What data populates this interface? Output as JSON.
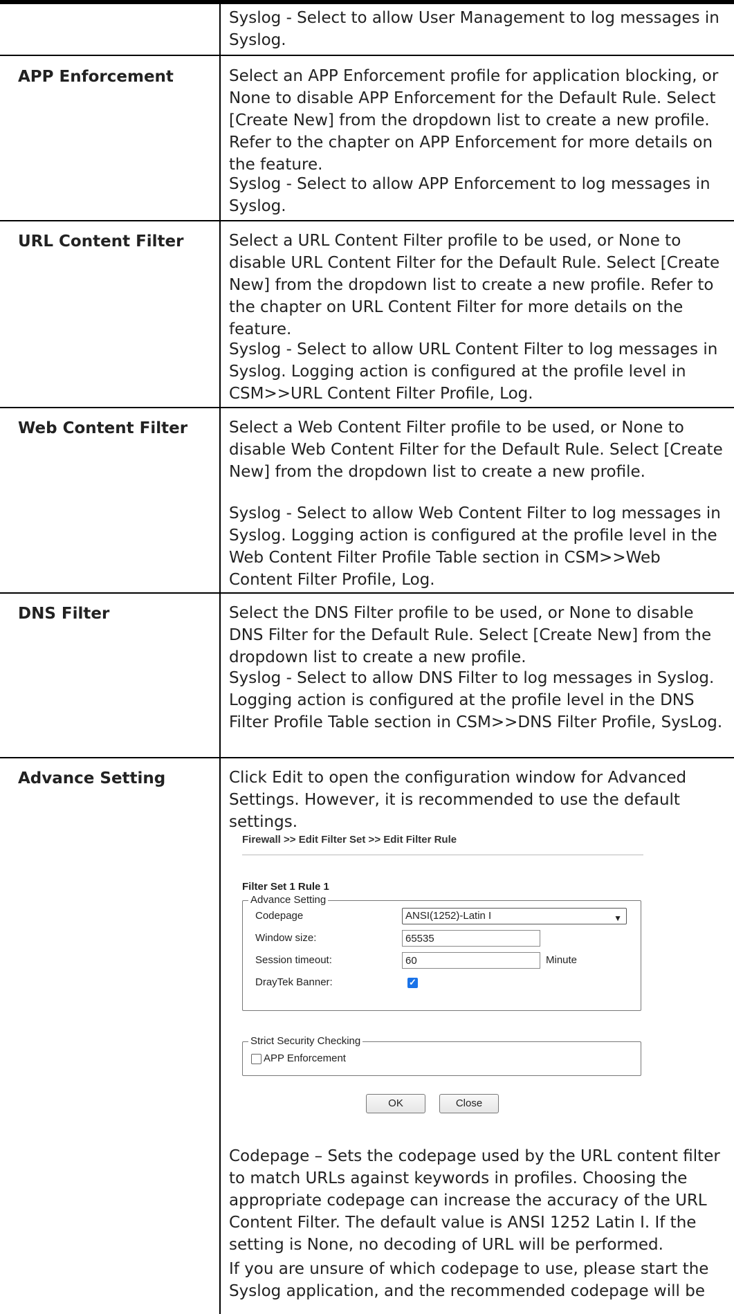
{
  "rows": {
    "user_management": {
      "syslog_keyword": "Syslog",
      "syslog_text": " - Select to allow User Management to log messages in Syslog."
    },
    "app_enforcement": {
      "label": "APP Enforcement",
      "desc": "Select an APP Enforcement profile for application blocking, or None to disable APP Enforcement for the Default Rule. Select [Create New] from the dropdown list to create a new profile. Refer to the chapter on APP Enforcement for more details on the feature.",
      "syslog_keyword": "Syslog",
      "syslog_text": " - Select to allow APP Enforcement to log messages in Syslog."
    },
    "url_content_filter": {
      "label": "URL Content Filter",
      "desc": "Select a URL Content Filter profile to be used, or None to disable URL Content Filter for the Default Rule. Select [Create New] from the dropdown list to create a new profile. Refer to the chapter on URL Content Filter for more details on the feature.",
      "syslog_keyword": "Syslog",
      "syslog_text": " - Select to allow URL Content Filter to log messages in Syslog. Logging action is configured at the profile level in CSM>>URL Content Filter Profile, Log."
    },
    "web_content_filter": {
      "label": "Web Content Filter",
      "desc": "Select a Web Content Filter profile to be used, or None to disable Web Content Filter for the Default Rule. Select [Create New] from the dropdown list to create a new profile.",
      "syslog_keyword": "Syslog",
      "syslog_text": " - Select to allow Web Content Filter to log messages in Syslog. Logging action is configured at the profile level in the Web Content Filter Profile Table section in CSM>>Web Content Filter Profile, Log."
    },
    "dns_filter": {
      "label": "DNS Filter",
      "desc": "Select the DNS Filter profile to be used, or None to disable DNS Filter for the Default Rule. Select [Create New] from the dropdown list to create a new profile.",
      "syslog_keyword": "Syslog",
      "syslog_text": " - Select to allow DNS Filter to log messages in Syslog. Logging action is configured at the profile level in the DNS Filter Profile Table section in CSM>>DNS Filter Profile, SysLog."
    },
    "advance_setting": {
      "label": "Advance Setting",
      "desc_pre": "Click ",
      "desc_keyword": "Edit",
      "desc_post": " to open the configuration window for Advanced Settings. However, it is recommended to use the default settings.",
      "codepage_keyword": "Codepage",
      "codepage_text": " – Sets the codepage used by the URL content filter to match URLs against keywords in profiles. Choosing the appropriate codepage can increase the accuracy of the URL Content Filter. The default value is ANSI 1252 Latin I. If the setting is None, no decoding of URL will be performed.",
      "unsure_text": "If you are unsure of which codepage to use, please start the Syslog application, and the recommended codepage will be"
    }
  },
  "screenshot": {
    "breadcrumb": "Firewall >> Edit Filter Set >> Edit Filter Rule",
    "set_title": "Filter Set 1 Rule 1",
    "advance_legend": "Advance Setting",
    "codepage_label": "Codepage",
    "codepage_value": "ANSI(1252)-Latin I",
    "window_size_label": "Window size:",
    "window_size_value": "65535",
    "session_timeout_label": "Session timeout:",
    "session_timeout_value": "60",
    "session_timeout_unit": "Minute",
    "banner_label": "DrayTek Banner:",
    "banner_checked": true,
    "strict_legend": "Strict Security Checking",
    "app_enforcement_label": "APP Enforcement",
    "app_enforcement_checked": false,
    "ok_label": "OK",
    "close_label": "Close"
  }
}
